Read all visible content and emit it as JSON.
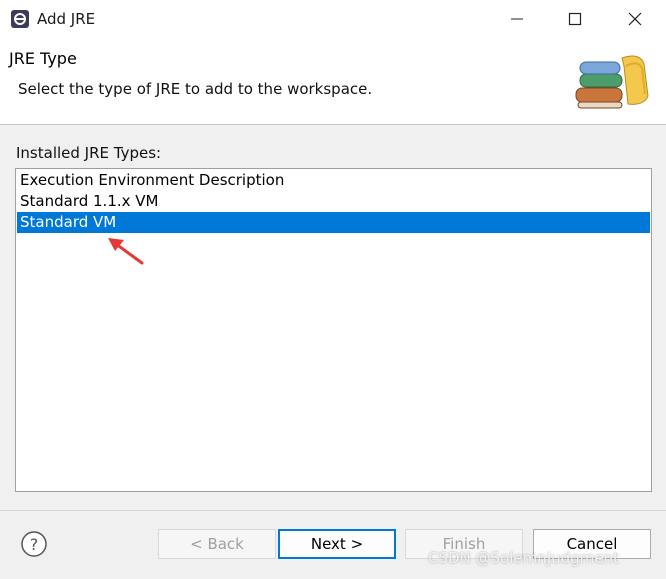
{
  "window": {
    "title": "Add JRE",
    "app_icon": "eclipse-icon"
  },
  "header": {
    "title": "JRE Type",
    "description": "Select the type of JRE to add to the workspace.",
    "icon": "library-books-icon"
  },
  "list": {
    "label": "Installed JRE Types:",
    "items": [
      {
        "label": "Execution Environment Description",
        "selected": false
      },
      {
        "label": "Standard 1.1.x VM",
        "selected": false
      },
      {
        "label": "Standard VM",
        "selected": true
      }
    ]
  },
  "footer": {
    "help_icon": "help-icon",
    "back": "< Back",
    "next": "Next >",
    "finish": "Finish",
    "cancel": "Cancel"
  },
  "watermark": "CSDN @SolemnJudgment",
  "colors": {
    "selection": "#0078d7",
    "annotation_arrow": "#e53935"
  }
}
